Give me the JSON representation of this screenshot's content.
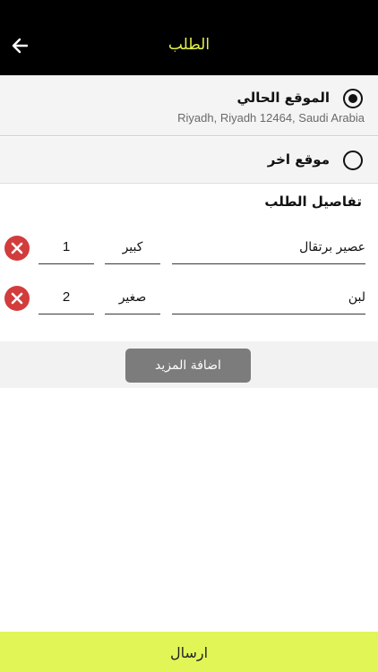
{
  "header": {
    "title": "الطلب",
    "back_icon": "arrow-left-icon"
  },
  "locations": [
    {
      "title": "الموقع الحالي",
      "address": "Riyadh, Riyadh 12464, Saudi Arabia",
      "selected": true
    },
    {
      "title": "موقع اخر",
      "selected": false
    }
  ],
  "order": {
    "title": "تفاصيل الطلب",
    "items": [
      {
        "name": "عصير برتقال",
        "size": "كبير",
        "quantity": "1"
      },
      {
        "name": "لبن",
        "size": "صغير",
        "quantity": "2"
      }
    ]
  },
  "add_more_label": "اضافة المزيد",
  "submit_label": "ارسال",
  "colors": {
    "accent": "#e1f557",
    "title_accent": "#e4f14a",
    "delete": "#d23c3c"
  }
}
